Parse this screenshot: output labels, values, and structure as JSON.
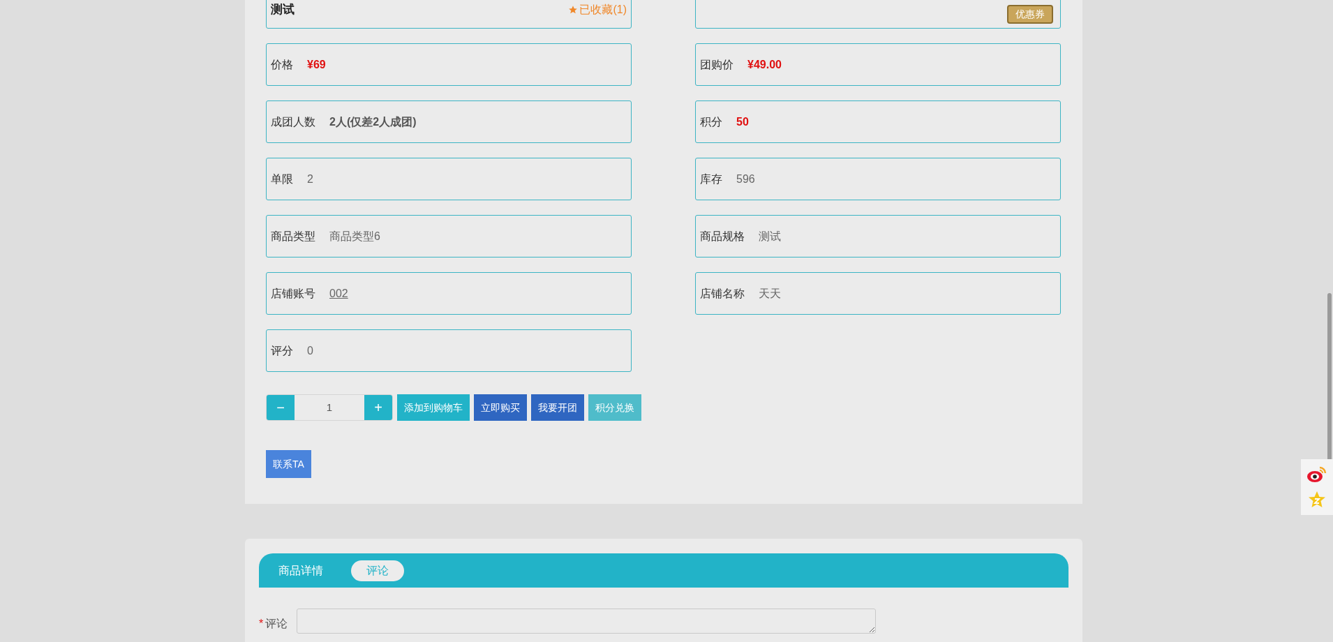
{
  "top_row": {
    "title": "测试",
    "favorite": "已收藏(1)",
    "coupon": "优惠券"
  },
  "fields": [
    {
      "label": "价格",
      "value": "¥69",
      "kind": "price"
    },
    {
      "label": "团购价",
      "value": "¥49.00",
      "kind": "price"
    },
    {
      "label": "成团人数",
      "value": "2人(仅差2人成团)",
      "kind": "bold"
    },
    {
      "label": "积分",
      "value": "50",
      "kind": "price"
    },
    {
      "label": "单限",
      "value": "2",
      "kind": "plain"
    },
    {
      "label": "库存",
      "value": "596",
      "kind": "plain"
    },
    {
      "label": "商品类型",
      "value": "商品类型6",
      "kind": "plain"
    },
    {
      "label": "商品规格",
      "value": "测试",
      "kind": "plain"
    },
    {
      "label": "店铺账号",
      "value": "002",
      "kind": "link"
    },
    {
      "label": "店铺名称",
      "value": "天天",
      "kind": "plain"
    },
    {
      "label": "评分",
      "value": "0",
      "kind": "plain"
    }
  ],
  "quantity": {
    "minus": "−",
    "value": "1",
    "plus": "+"
  },
  "actions": [
    {
      "label": "添加到购物车",
      "kind": "teal"
    },
    {
      "label": "立即购买",
      "kind": "blue"
    },
    {
      "label": "我要开团",
      "kind": "blue"
    },
    {
      "label": "积分兑换",
      "kind": "light"
    }
  ],
  "contact_button": "联系TA",
  "tabs": [
    {
      "label": "商品详情",
      "selected": false
    },
    {
      "label": "评论",
      "selected": true
    }
  ],
  "comment": {
    "required_mark": "*",
    "label": "评论"
  }
}
